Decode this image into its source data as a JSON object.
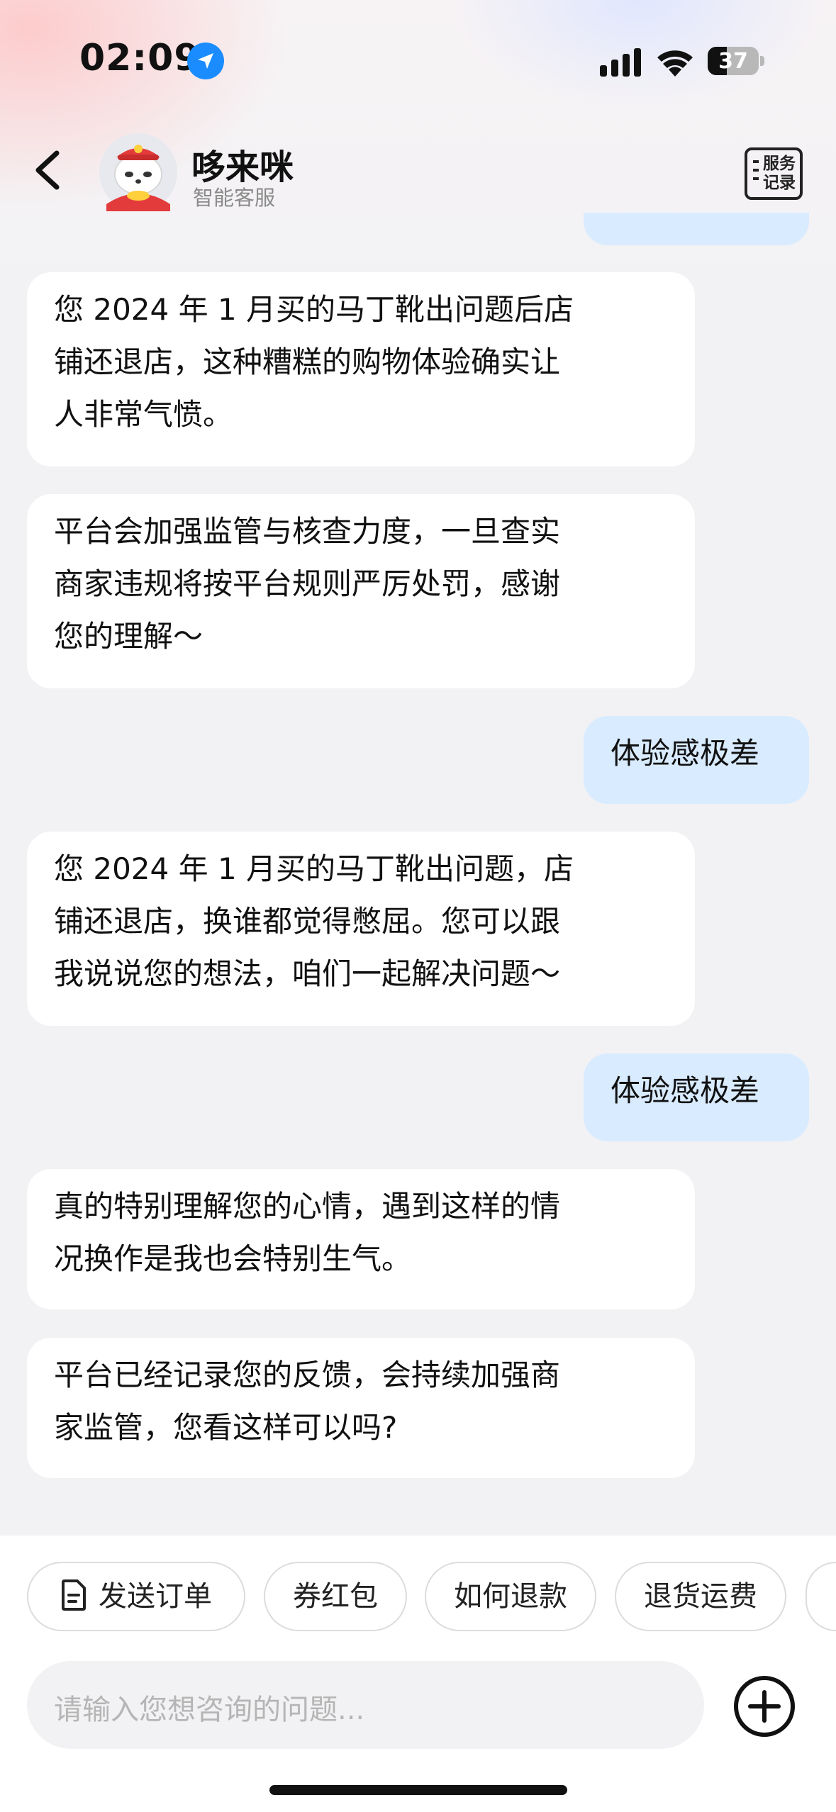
{
  "status_bar": {
    "time": "02:09",
    "battery": "37",
    "battery_level": 0.37
  },
  "header": {
    "title": "哆来咪",
    "subtitle": "智能客服",
    "service_record_label": "服务记录",
    "service_record_line1": "服务",
    "service_record_line2": "记录"
  },
  "messages": [
    {
      "role": "bot",
      "lines": [
        "您 2024 年 1 月买的马丁靴出问题后店",
        "铺还退店，这种糟糕的购物体验确实让",
        "人非常气愤。"
      ]
    },
    {
      "role": "bot",
      "lines": [
        "平台会加强监管与核查力度，一旦查实",
        "商家违规将按平台规则严厉处罚，感谢",
        "您的理解～"
      ]
    },
    {
      "role": "user",
      "text": "体验感极差"
    },
    {
      "role": "bot",
      "lines": [
        "您 2024 年 1 月买的马丁靴出问题，店",
        "铺还退店，换谁都觉得憋屈。您可以跟",
        "我说说您的想法，咱们一起解决问题～"
      ]
    },
    {
      "role": "user",
      "text": "体验感极差"
    },
    {
      "role": "bot",
      "lines": [
        "真的特别理解您的心情，遇到这样的情",
        "况换作是我也会特别生气。"
      ]
    },
    {
      "role": "bot",
      "lines": [
        "平台已经记录您的反馈，会持续加强商",
        "家监管，您看这样可以吗?"
      ]
    }
  ],
  "quick_actions": [
    "发送订单",
    "券红包",
    "如何退款",
    "退货运费"
  ],
  "input": {
    "placeholder": "请输入您想咨询的问题..."
  },
  "icons": [
    "location-arrow-icon",
    "signal-icon",
    "wifi-icon",
    "battery-icon",
    "back-chevron-icon",
    "avatar-mascot",
    "service-record-icon",
    "document-icon",
    "plus-circle-icon"
  ]
}
